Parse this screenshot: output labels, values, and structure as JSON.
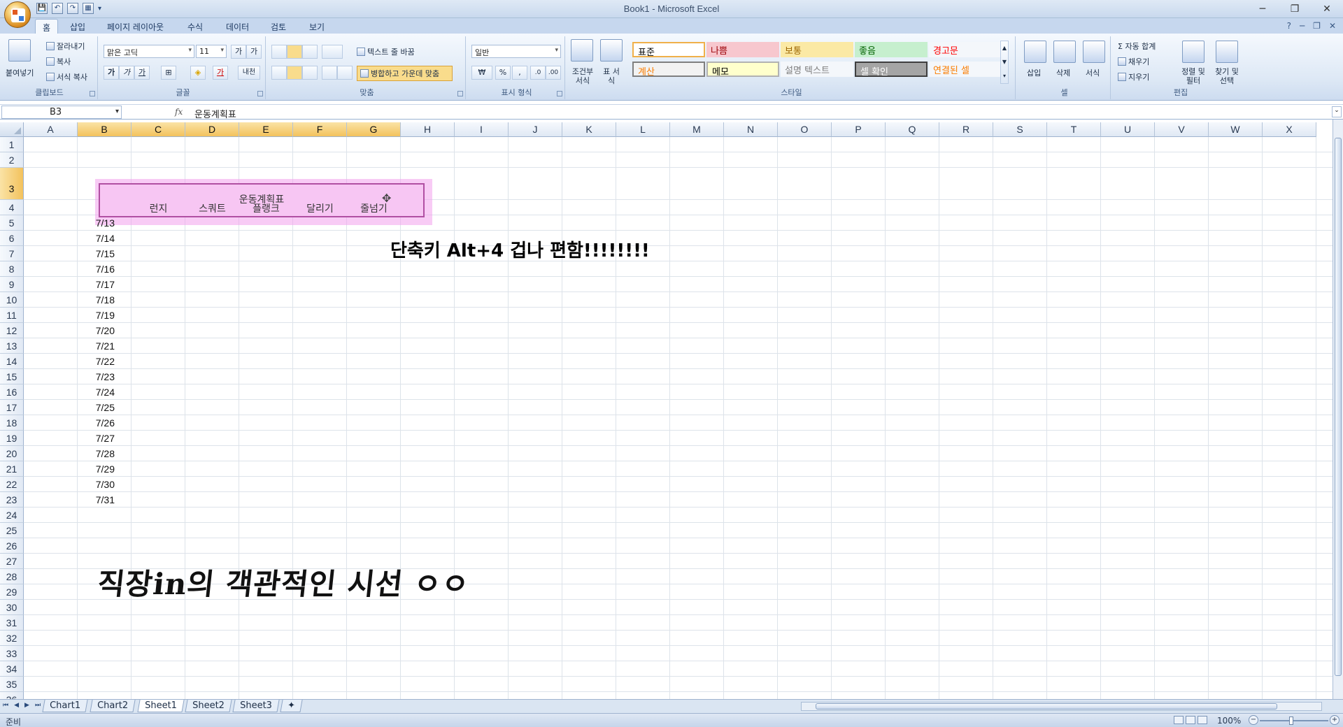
{
  "window": {
    "title": "Book1 - Microsoft Excel",
    "controls": [
      "─",
      "❐",
      "✕"
    ]
  },
  "quick_access": [
    "💾",
    "↶",
    "↷",
    "▦",
    "▾"
  ],
  "ribbon_tabs": [
    "홈",
    "삽입",
    "페이지 레이아웃",
    "수식",
    "데이터",
    "검토",
    "보기"
  ],
  "help_icons": [
    "?",
    "─",
    "❐",
    "✕"
  ],
  "ribbon": {
    "clipboard": {
      "label": "클립보드",
      "paste": "붙여넣기",
      "cut": "잘라내기",
      "copy": "복사",
      "format_painter": "서식 복사"
    },
    "font": {
      "label": "글꼴",
      "font_name": "맑은 고딕",
      "font_size": "11",
      "grow": "가",
      "shrink": "가",
      "bold": "가",
      "italic": "가",
      "underline": "가",
      "border": "⊞",
      "fill": "◈",
      "color": "가",
      "phonetic": "내천"
    },
    "alignment": {
      "label": "맞춤",
      "wrap": "텍스트 줄 바꿈",
      "merge": "병합하고 가운데 맞춤"
    },
    "number": {
      "label": "표시 형식",
      "format": "일반",
      "currency": "₩",
      "percent": "%",
      "comma": ",",
      "inc_decimal": ".0",
      "dec_decimal": ".00"
    },
    "styles": {
      "label": "스타일",
      "conditional": "조건부 서식",
      "table_format": "표 서식",
      "cells": [
        {
          "text": "표준",
          "bg": "#ffffff",
          "fg": "#000000",
          "border": "#f0b04a"
        },
        {
          "text": "나쁨",
          "bg": "#f7c7ce",
          "fg": "#9c0006",
          "border": ""
        },
        {
          "text": "보통",
          "bg": "#fbe9a5",
          "fg": "#9c6500",
          "border": ""
        },
        {
          "text": "좋음",
          "bg": "#c6efce",
          "fg": "#006100",
          "border": ""
        },
        {
          "text": "경고문",
          "bg": "#f4f7fb",
          "fg": "#ff0000",
          "border": ""
        },
        {
          "text": "계산",
          "bg": "#f2f2f2",
          "fg": "#fa7d00",
          "border": "#7f7f7f"
        },
        {
          "text": "메모",
          "bg": "#ffffcc",
          "fg": "#000000",
          "border": "#b2b2b2"
        },
        {
          "text": "설명 텍스트",
          "bg": "#f4f7fb",
          "fg": "#7f7f7f",
          "border": ""
        },
        {
          "text": "셀 확인",
          "bg": "#a5a5a5",
          "fg": "#ffffff",
          "border": "#3f3f3f"
        },
        {
          "text": "연결된 셀",
          "bg": "#f4f7fb",
          "fg": "#fa7d00",
          "border": ""
        }
      ]
    },
    "cells": {
      "label": "셀",
      "insert": "삽입",
      "delete": "삭제",
      "format": "서식"
    },
    "editing": {
      "label": "편집",
      "autosum": "Σ 자동 합계",
      "fill": "채우기",
      "clear": "지우기",
      "sort": "정렬 및 필터",
      "find": "찾기 및 선택"
    }
  },
  "formula_bar": {
    "name_box": "B3",
    "fx": "fx",
    "content": "운동계획표"
  },
  "columns": [
    "A",
    "B",
    "C",
    "D",
    "E",
    "F",
    "G",
    "H",
    "I",
    "J",
    "K",
    "L",
    "M",
    "N",
    "O",
    "P",
    "Q",
    "R",
    "S",
    "T",
    "U",
    "V",
    "W",
    "X"
  ],
  "rows": [
    "1",
    "2",
    "3",
    "4",
    "5",
    "6",
    "7",
    "8",
    "9",
    "10",
    "11",
    "12",
    "13",
    "14",
    "15",
    "16",
    "17",
    "18",
    "19",
    "20",
    "21",
    "22",
    "23",
    "24",
    "25",
    "26",
    "27",
    "28",
    "29",
    "30",
    "31",
    "32",
    "33",
    "34",
    "35",
    "36"
  ],
  "sheet": {
    "merged_title": "운동계획표",
    "headers": [
      "런지",
      "스쿼트",
      "플랭크",
      "달리기",
      "줄넘기"
    ],
    "dates": [
      "7/13",
      "7/14",
      "7/15",
      "7/16",
      "7/17",
      "7/18",
      "7/19",
      "7/20",
      "7/21",
      "7/22",
      "7/23",
      "7/24",
      "7/25",
      "7/26",
      "7/27",
      "7/28",
      "7/29",
      "7/30",
      "7/31"
    ],
    "note": "단축키 Alt+4 겁나 편함!!!!!!!!",
    "handwritten": "직장in의 객관적인 시선 ㅇㅇ"
  },
  "sheet_tabs": [
    "Chart1",
    "Chart2",
    "Sheet1",
    "Sheet2",
    "Sheet3"
  ],
  "active_sheet": "Sheet1",
  "sheet_nav": [
    "⏮",
    "◀",
    "▶",
    "⏭"
  ],
  "status": {
    "ready": "준비",
    "zoom": "100%"
  }
}
